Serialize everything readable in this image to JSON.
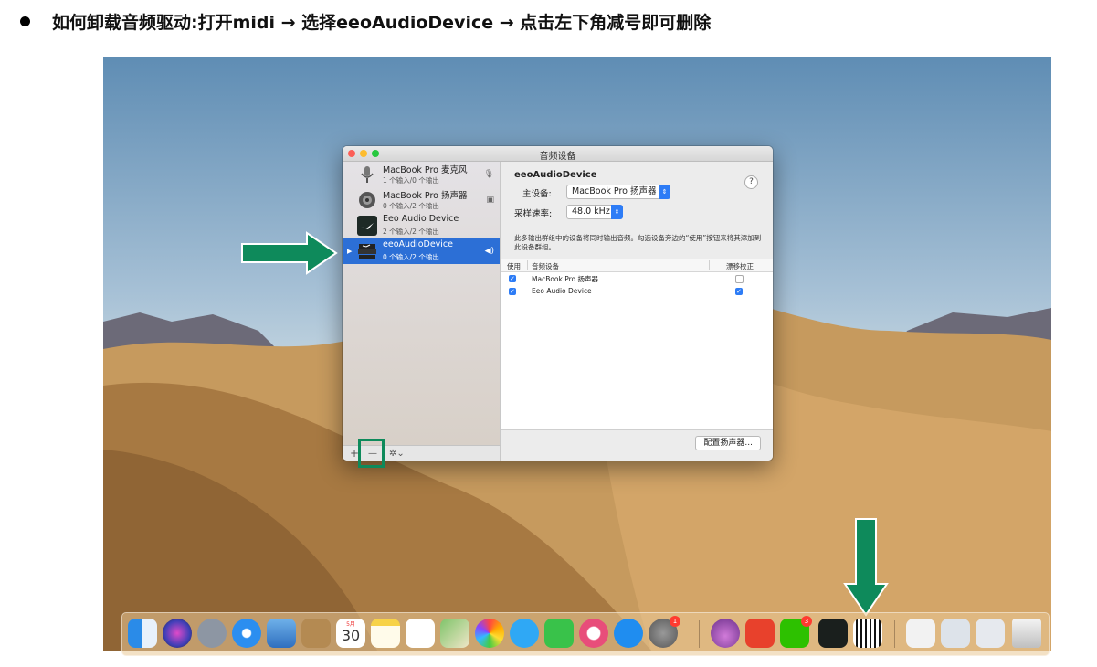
{
  "instruction": "如何卸载音频驱动:打开midi → 选择eeoAudioDevice → 点击左下角减号即可删除",
  "window": {
    "title": "音频设备",
    "devices": [
      {
        "name": "MacBook Pro 麦克风",
        "sub": "1 个输入/0 个输出",
        "icon": "microphone-icon",
        "right": "🎙"
      },
      {
        "name": "MacBook Pro 扬声器",
        "sub": "0 个输入/2 个输出",
        "icon": "speaker-icon",
        "right": "▣"
      },
      {
        "name": "Eeo Audio Device",
        "sub": "2 个输入/2 个输出",
        "icon": "eeo-bird-icon",
        "right": ""
      },
      {
        "name": "eeoAudioDevice",
        "sub": "0 个输入/2 个输出",
        "icon": "aggregate-device-icon",
        "right": "◀)",
        "selected": true
      }
    ],
    "toolbar": {
      "add": "+",
      "remove": "—",
      "gear": "✲⌄"
    },
    "detail": {
      "device_name": "eeoAudioDevice",
      "help": "?",
      "master_label": "主设备:",
      "master_value": "MacBook Pro 扬声器",
      "rate_label": "采样速率:",
      "rate_value": "48.0 kHz",
      "description": "此多输出群组中的设备将同时输出音频。勾选设备旁边的“使用”按钮来将其添加到此设备群组。",
      "columns": {
        "use": "使用",
        "device": "音频设备",
        "drift": "漂移校正"
      },
      "rows": [
        {
          "device": "MacBook Pro 扬声器",
          "use": true,
          "drift": false
        },
        {
          "device": "Eeo Audio Device",
          "use": true,
          "drift": true
        }
      ],
      "configure_button": "配置扬声器..."
    }
  },
  "dock": {
    "calendar_month": "5月",
    "calendar_day": "30",
    "badges": {
      "system_prefs": "1",
      "wechat": "3"
    },
    "icons": [
      "finder-icon",
      "siri-icon",
      "launchpad-icon",
      "safari-icon",
      "mail-icon",
      "contacts-icon",
      "calendar-icon",
      "notes-icon",
      "reminders-icon",
      "maps-icon",
      "photos-icon",
      "messages-icon",
      "facetime-icon",
      "itunes-icon",
      "app-store-icon",
      "system-preferences-icon",
      "install-app-icon",
      "presentation-app-icon",
      "wechat-icon",
      "eeo-app-icon",
      "midi-keyboard-icon",
      "document-icon",
      "finder-window-icon",
      "screenshot-icon",
      "trash-icon"
    ]
  },
  "colors": {
    "arrow": "#0e8a5b",
    "selection": "#2c6fd6",
    "accent": "#2d7cf6"
  }
}
